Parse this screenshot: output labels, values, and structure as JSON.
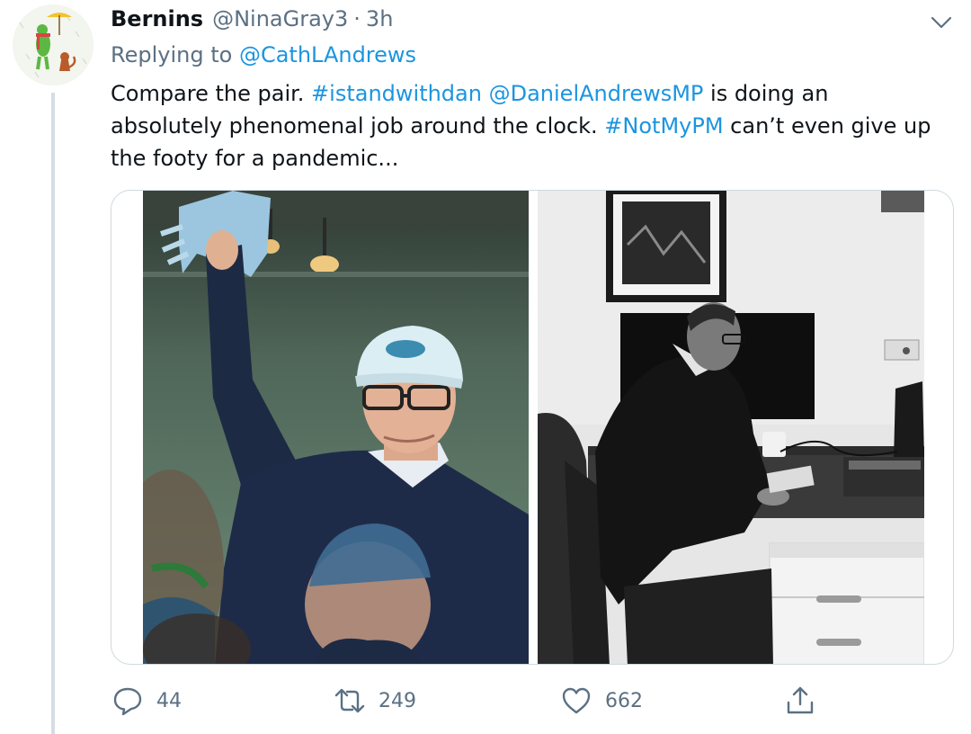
{
  "tweet": {
    "author": {
      "display_name": "Bernins",
      "handle": "@NinaGray3",
      "separator": "·",
      "time": "3h"
    },
    "replying_to_prefix": "Replying to ",
    "replying_to_handle": "@CathLAndrews",
    "text_lines": [
      [
        {
          "text": "Compare the pair. ",
          "type": "text"
        },
        {
          "text": "#istandwithdan",
          "type": "hashtag"
        },
        {
          "text": " ",
          "type": "text"
        },
        {
          "text": "@DanielAndrewsMP",
          "type": "mention"
        },
        {
          "text": " is doing an",
          "type": "text"
        }
      ],
      [
        {
          "text": "absolutely phenomenal job around the clock. ",
          "type": "text"
        },
        {
          "text": "#NotMyPM",
          "type": "hashtag"
        },
        {
          "text": " can’t even give up",
          "type": "text"
        }
      ],
      [
        {
          "text": "the footy for a pandemic...",
          "type": "text"
        }
      ]
    ],
    "media": [
      {
        "icon": "photo-man-in-cap-waving-scarf"
      },
      {
        "icon": "photo-man-working-at-desk-grayscale"
      }
    ],
    "actions": {
      "reply_count": "44",
      "retweet_count": "249",
      "like_count": "662"
    }
  },
  "colors": {
    "link": "#1b95e0",
    "secondary_text": "#5b7083",
    "primary_text": "#0f1419",
    "thread_line": "#d6dde2",
    "media_border": "#cfd9de"
  }
}
